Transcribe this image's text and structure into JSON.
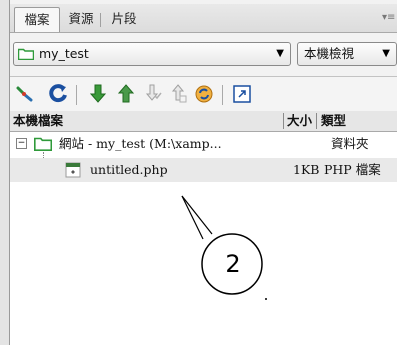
{
  "tabs": [
    {
      "label": "檔案",
      "active": true
    },
    {
      "label": "資源",
      "active": false
    },
    {
      "label": "片段",
      "active": false
    }
  ],
  "site_select": {
    "value": "my_test"
  },
  "view_select": {
    "value": "本機檢視"
  },
  "columns": {
    "name": "本機檔案",
    "size": "大小",
    "type": "類型"
  },
  "tree": [
    {
      "expander": "⊟",
      "name": "網站 - my_test (M:\\xamp...",
      "size": "",
      "type": "資料夾",
      "icon": "folder-icon"
    },
    {
      "name": "untitled.php",
      "size": "1KB",
      "type": "PHP 檔案",
      "icon": "php-file-icon"
    }
  ],
  "callout": {
    "number": "2"
  },
  "colors": {
    "folder": "#2f9a3a",
    "arrows": "#2a8a3a",
    "refresh": "#1a4fa0"
  }
}
